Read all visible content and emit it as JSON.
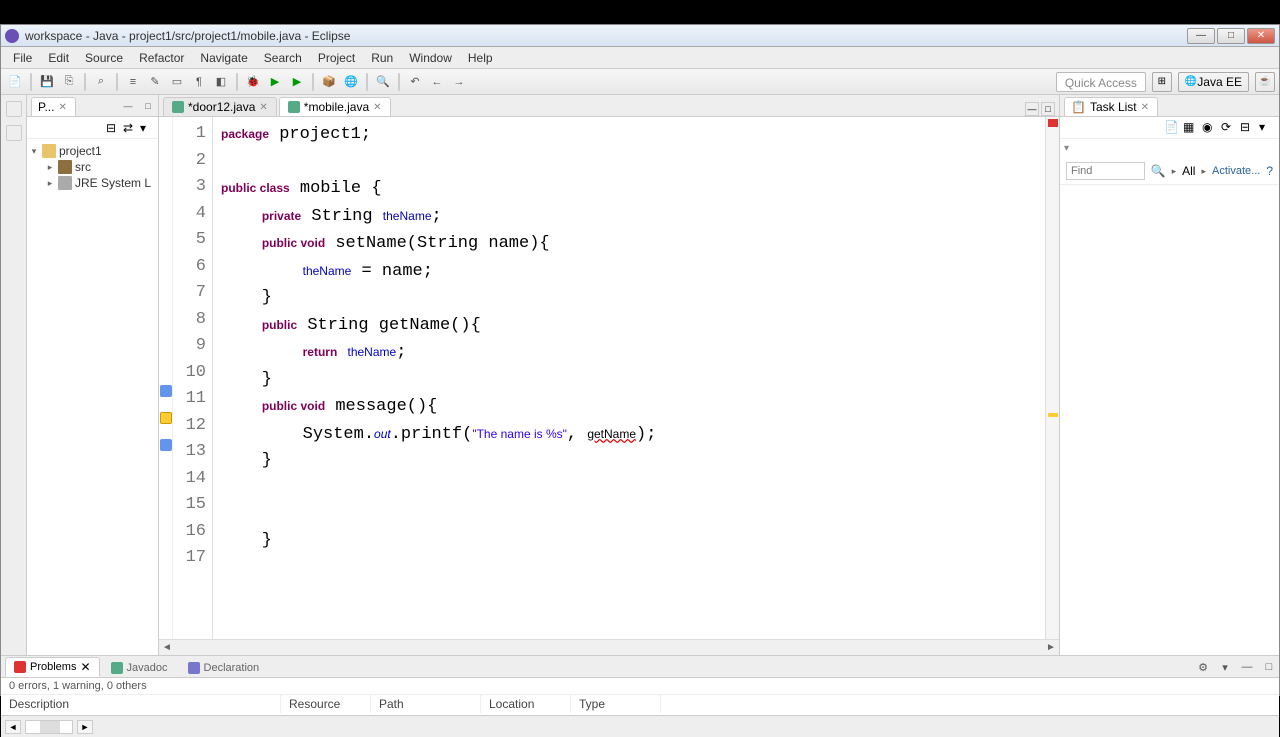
{
  "title": "workspace - Java - project1/src/project1/mobile.java - Eclipse",
  "menus": [
    "File",
    "Edit",
    "Source",
    "Refactor",
    "Navigate",
    "Search",
    "Project",
    "Run",
    "Window",
    "Help"
  ],
  "quick_access": "Quick Access",
  "perspective_label": "Java EE",
  "package_explorer": {
    "tab": "P...",
    "project": "project1",
    "src": "src",
    "jre": "JRE System L"
  },
  "editor": {
    "tabs": [
      {
        "label": "*door12.java",
        "active": false
      },
      {
        "label": "*mobile.java",
        "active": true
      }
    ],
    "lines": [
      {
        "n": 1,
        "tokens": [
          {
            "t": "package",
            "c": "kw"
          },
          {
            "t": " project1;"
          }
        ]
      },
      {
        "n": 2,
        "tokens": []
      },
      {
        "n": 3,
        "tokens": [
          {
            "t": "public class",
            "c": "kw"
          },
          {
            "t": " mobile {"
          }
        ]
      },
      {
        "n": 4,
        "tokens": [
          {
            "t": "    "
          },
          {
            "t": "private",
            "c": "kw"
          },
          {
            "t": " String "
          },
          {
            "t": "theName",
            "c": "fld"
          },
          {
            "t": ";"
          }
        ]
      },
      {
        "n": 5,
        "tokens": [
          {
            "t": "    "
          },
          {
            "t": "public void",
            "c": "kw"
          },
          {
            "t": " setName(String name){"
          }
        ]
      },
      {
        "n": 6,
        "tokens": [
          {
            "t": "        "
          },
          {
            "t": "theName",
            "c": "fld"
          },
          {
            "t": " = name;"
          }
        ]
      },
      {
        "n": 7,
        "tokens": [
          {
            "t": "    }"
          }
        ]
      },
      {
        "n": 8,
        "tokens": [
          {
            "t": "    "
          },
          {
            "t": "public",
            "c": "kw"
          },
          {
            "t": " String getName(){"
          }
        ]
      },
      {
        "n": 9,
        "tokens": [
          {
            "t": "        "
          },
          {
            "t": "return",
            "c": "kw"
          },
          {
            "t": " "
          },
          {
            "t": "theName",
            "c": "fld"
          },
          {
            "t": ";"
          }
        ]
      },
      {
        "n": 10,
        "tokens": [
          {
            "t": "    }"
          }
        ]
      },
      {
        "n": 11,
        "tokens": [
          {
            "t": "    "
          },
          {
            "t": "public void",
            "c": "kw"
          },
          {
            "t": " message(){"
          }
        ]
      },
      {
        "n": 12,
        "tokens": [
          {
            "t": "        System."
          },
          {
            "t": "out",
            "c": "stat"
          },
          {
            "t": ".printf("
          },
          {
            "t": "\"The name is %s\"",
            "c": "str"
          },
          {
            "t": ", "
          },
          {
            "t": "getName",
            "c": "err"
          },
          {
            "t": ");"
          }
        ]
      },
      {
        "n": 13,
        "tokens": [
          {
            "t": "    }"
          }
        ]
      },
      {
        "n": 14,
        "tokens": []
      },
      {
        "n": 15,
        "tokens": []
      },
      {
        "n": 16,
        "tokens": [
          {
            "t": "    }"
          }
        ]
      },
      {
        "n": 17,
        "tokens": []
      }
    ]
  },
  "tasklist": {
    "tab": "Task List",
    "find": "Find",
    "all": "All",
    "activate": "Activate..."
  },
  "problems": {
    "tabs": [
      "Problems",
      "Javadoc",
      "Declaration"
    ],
    "status": "0 errors, 1 warning, 0 others",
    "cols": [
      "Description",
      "Resource",
      "Path",
      "Location",
      "Type"
    ]
  }
}
